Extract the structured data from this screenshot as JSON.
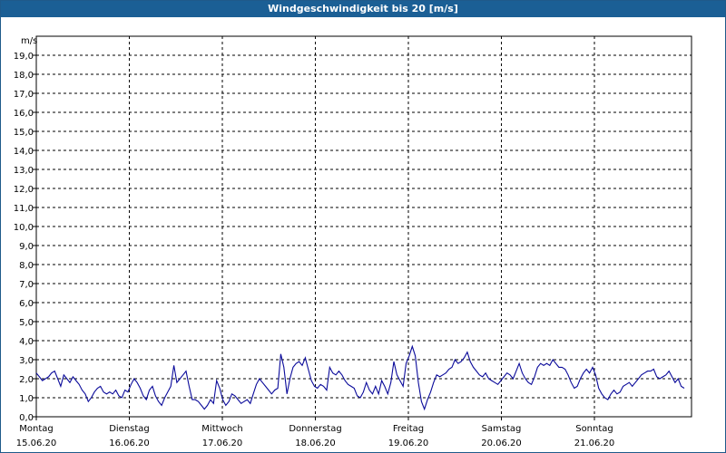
{
  "window": {
    "title": "Windgeschwindigkeit bis 20 [m/s]"
  },
  "colors": {
    "titlebar": "#1b5f95",
    "line": "#0a0a9a",
    "grid": "#000000"
  },
  "chart_data": {
    "type": "line",
    "title": "Windgeschwindigkeit bis 20 [m/s]",
    "ylabel": "m/s",
    "ylim": [
      0,
      20
    ],
    "y_ticks": [
      "0,0",
      "1,0",
      "2,0",
      "3,0",
      "4,0",
      "5,0",
      "6,0",
      "7,0",
      "8,0",
      "9,0",
      "10,0",
      "11,0",
      "12,0",
      "13,0",
      "14,0",
      "15,0",
      "16,0",
      "17,0",
      "18,0",
      "19,0"
    ],
    "x_ticks": [
      {
        "day": "Montag",
        "date": "15.06.20"
      },
      {
        "day": "Dienstag",
        "date": "16.06.20"
      },
      {
        "day": "Mittwoch",
        "date": "17.06.20"
      },
      {
        "day": "Donnerstag",
        "date": "18.06.20"
      },
      {
        "day": "Freitag",
        "date": "19.06.20"
      },
      {
        "day": "Samstag",
        "date": "20.06.20"
      },
      {
        "day": "Sonntag",
        "date": "21.06.20"
      }
    ],
    "grid": true,
    "series": [
      {
        "values": [
          2.3,
          2.1,
          1.9,
          2.0,
          2.1,
          2.3,
          2.4,
          2.0,
          1.6,
          2.2,
          2.0,
          1.8,
          2.1,
          1.9,
          1.7,
          1.4,
          1.2,
          0.8,
          1.0,
          1.3,
          1.5,
          1.6,
          1.3,
          1.2,
          1.3,
          1.2,
          1.4,
          1.1,
          1.0,
          1.4,
          1.3,
          1.7,
          2.0,
          1.8,
          1.5,
          1.1,
          0.9,
          1.4,
          1.6,
          1.1,
          0.8,
          0.6,
          1.0,
          1.3,
          1.6,
          2.7,
          1.8,
          2.0,
          2.2,
          2.4,
          1.6,
          0.9,
          0.9,
          0.8,
          0.6,
          0.4,
          0.6,
          0.9,
          0.7,
          1.9,
          1.5,
          0.9,
          0.6,
          0.8,
          1.2,
          1.1,
          0.9,
          0.7,
          0.8,
          0.9,
          0.7,
          1.2,
          1.7,
          2.0,
          1.8,
          1.6,
          1.4,
          1.2,
          1.4,
          1.5,
          3.3,
          2.6,
          1.2,
          2.0,
          2.6,
          2.8,
          2.9,
          2.7,
          3.1,
          2.5,
          1.9,
          1.6,
          1.5,
          1.7,
          1.6,
          1.4,
          2.6,
          2.3,
          2.2,
          2.4,
          2.2,
          1.9,
          1.7,
          1.6,
          1.5,
          1.1,
          1.0,
          1.3,
          1.8,
          1.4,
          1.2,
          1.6,
          1.2,
          1.9,
          1.6,
          1.2,
          1.8,
          2.9,
          2.2,
          1.9,
          1.6,
          2.8,
          3.2,
          3.7,
          3.2,
          1.8,
          0.8,
          0.4,
          0.9,
          1.3,
          1.8,
          2.2,
          2.1,
          2.2,
          2.3,
          2.5,
          2.6,
          3.0,
          2.8,
          2.9,
          3.1,
          3.4,
          2.9,
          2.6,
          2.4,
          2.2,
          2.1,
          2.3,
          2.0,
          1.9,
          1.8,
          1.7,
          1.9,
          2.1,
          2.3,
          2.2,
          2.0,
          2.4,
          2.8,
          2.3,
          2.0,
          1.8,
          1.7,
          2.1,
          2.6,
          2.8,
          2.7,
          2.8,
          2.7,
          3.0,
          2.8,
          2.6,
          2.6,
          2.5,
          2.2,
          1.8,
          1.5,
          1.6,
          2.0,
          2.3,
          2.5,
          2.3,
          2.6,
          2.2,
          1.5,
          1.2,
          1.0,
          0.9,
          1.2,
          1.4,
          1.2,
          1.3,
          1.6,
          1.7,
          1.8,
          1.6,
          1.8,
          2.0,
          2.2,
          2.3,
          2.4,
          2.4,
          2.5,
          2.1,
          2.0,
          2.1,
          2.2,
          2.4,
          2.1,
          1.8,
          2.0,
          1.6,
          1.5
        ]
      }
    ]
  }
}
